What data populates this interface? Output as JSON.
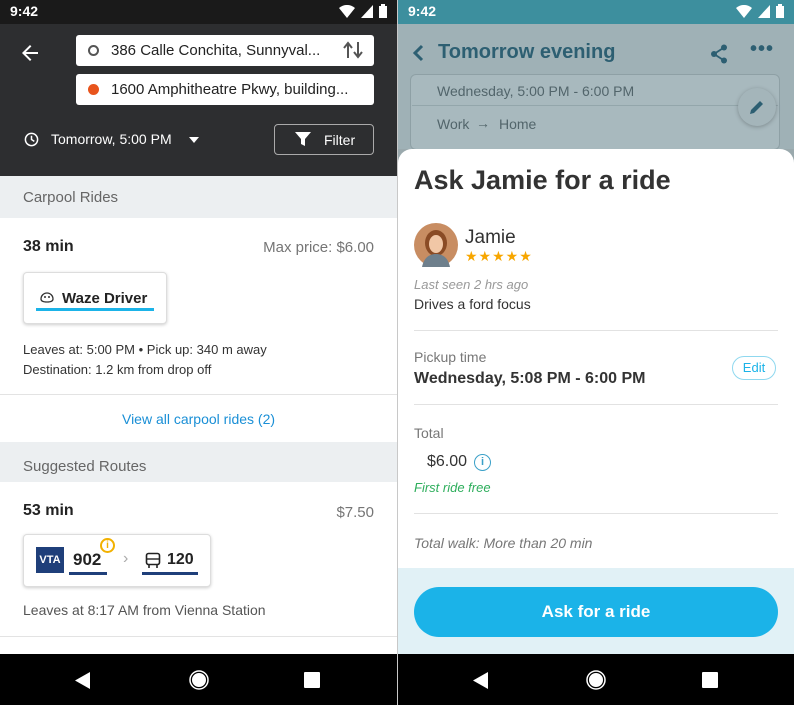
{
  "left": {
    "status_time": "9:42",
    "origin": "386 Calle Conchita, Sunnyval...",
    "destination": "1600 Amphitheatre Pkwy, building...",
    "when": "Tomorrow, 5:00 PM",
    "filter_label": "Filter",
    "carpool": {
      "section_title": "Carpool Rides",
      "duration": "38 min",
      "max_price": "Max price:  $6.00",
      "badge_label": "Waze Driver",
      "leaves": "Leaves at: 5:00 PM • Pick up: 340 m away",
      "destination_info": "Destination: 1.2 km from drop off",
      "view_all": "View all carpool rides (2)"
    },
    "suggested": {
      "section_title": "Suggested Routes",
      "duration": "53 min",
      "price": "$7.50",
      "agency_logo": "VTA",
      "line1": "902",
      "line2": "120",
      "leaves": "Leaves at 8:17 AM from Vienna Station"
    }
  },
  "right": {
    "status_time": "9:42",
    "header_title": "Tomorrow evening",
    "time_range": "Wednesday, 5:00 PM - 6:00 PM",
    "route_from": "Work",
    "route_to": "Home",
    "sheet_title": "Ask Jamie for a ride",
    "driver_name": "Jamie",
    "stars": "★★★★★",
    "last_seen": "Last seen 2 hrs ago",
    "car": "Drives a ford focus",
    "pickup_label": "Pickup time",
    "pickup_value": "Wednesday, 5:08 PM - 6:00 PM",
    "edit_label": "Edit",
    "total_label": "Total",
    "total_value": "$6.00",
    "first_ride": "First ride free",
    "walk": "Total walk: More than 20 min",
    "cta": "Ask for a ride"
  },
  "colors": {
    "accent": "#1bb3e8",
    "green": "#2eae5c",
    "star": "#f7a600",
    "link": "#1a8fd6",
    "vta": "#1f3f7a"
  },
  "icons": [
    "back-arrow-icon",
    "origin-dot-icon",
    "destination-dot-icon",
    "swap-icon",
    "clock-icon",
    "filter-icon",
    "waze-icon",
    "info-icon",
    "bus-icon",
    "share-icon",
    "more-icon",
    "pencil-icon",
    "arrow-right-icon"
  ]
}
